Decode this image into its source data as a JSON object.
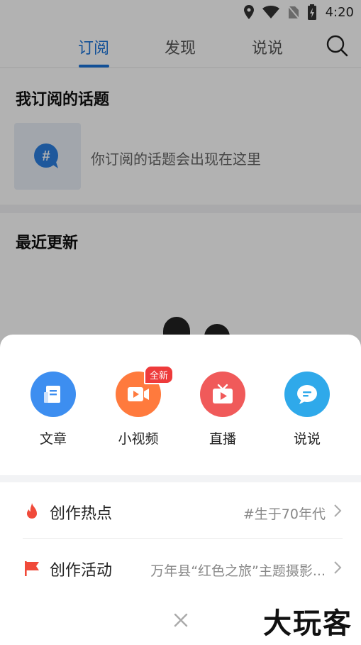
{
  "status_bar": {
    "time": "4:20"
  },
  "top_nav": {
    "tabs": [
      {
        "label": "订阅"
      },
      {
        "label": "发现"
      },
      {
        "label": "说说"
      }
    ]
  },
  "subscribed": {
    "title": "我订阅的话题",
    "hint": "你订阅的话题会出现在这里"
  },
  "recent": {
    "title": "最近更新"
  },
  "sheet": {
    "actions": [
      {
        "label": "文章",
        "color": "#3d8ef0"
      },
      {
        "label": "小视频",
        "color": "#ff7a3d",
        "badge": "全新"
      },
      {
        "label": "直播",
        "color": "#f05a5a"
      },
      {
        "label": "说说",
        "color": "#2fa9ea"
      }
    ],
    "rows": [
      {
        "label": "创作热点",
        "value": "#生于70年代"
      },
      {
        "label": "创作活动",
        "value": "万年县“红色之旅”主题摄影..."
      }
    ]
  },
  "watermark": "大玩客",
  "colors": {
    "accent": "#1a73d9",
    "fire": "#f04a3a"
  }
}
